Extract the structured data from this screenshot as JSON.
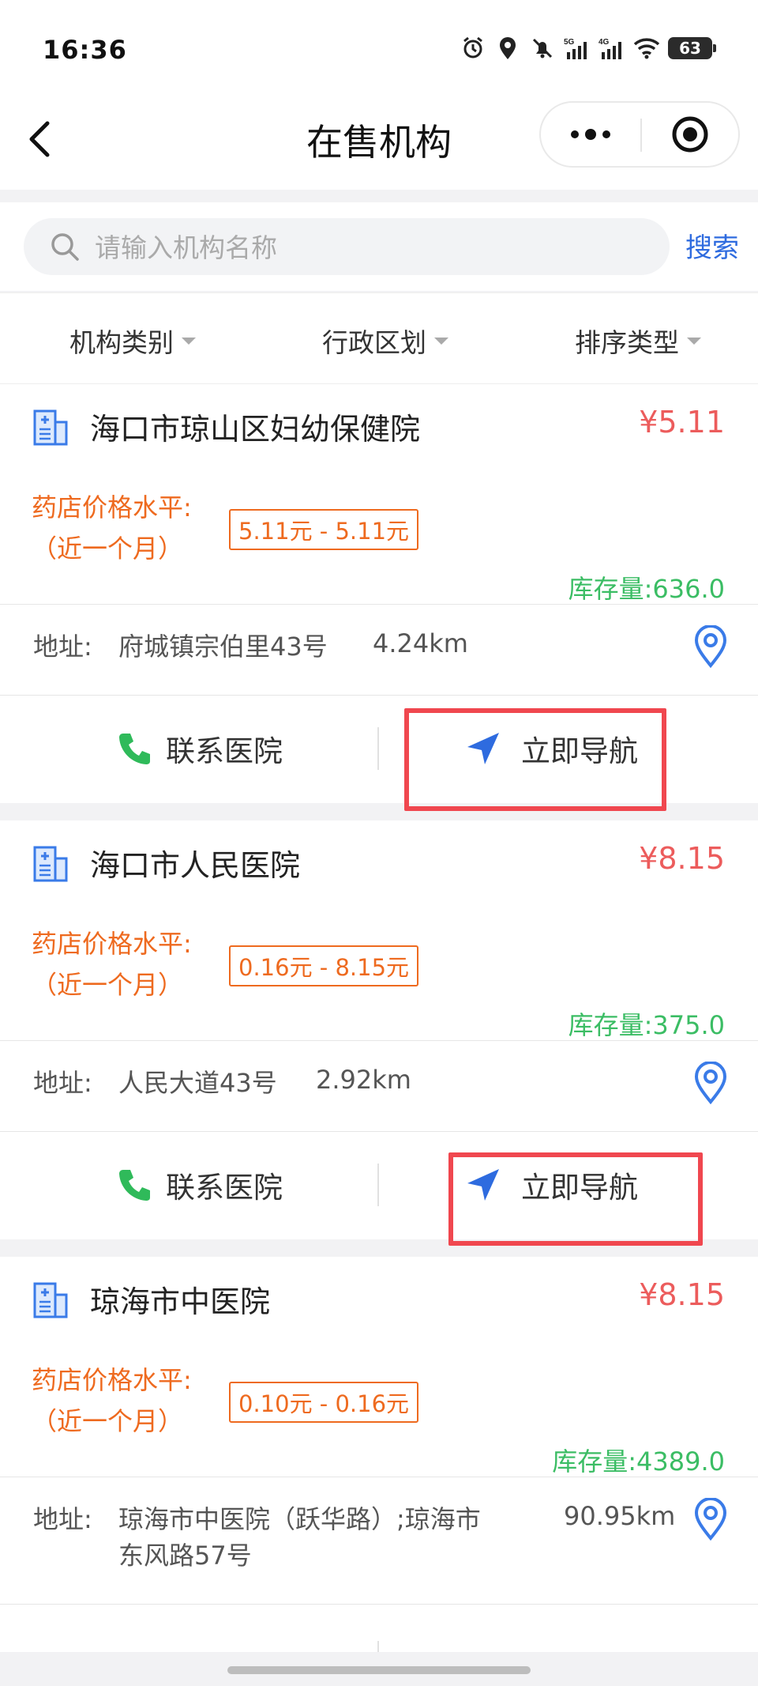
{
  "status": {
    "time": "16:36",
    "battery": "63",
    "net1": "5G",
    "net2": "4G"
  },
  "nav": {
    "title": "在售机构"
  },
  "search": {
    "placeholder": "请输入机构名称",
    "button": "搜索"
  },
  "filters": [
    "机构类别",
    "行政区划",
    "排序类型"
  ],
  "labels": {
    "level_line1": "药店价格水平:",
    "level_line2": "（近一个月）",
    "stock_prefix": "库存量:",
    "addr_prefix": "地址:",
    "call": "联系医院",
    "navigate": "立即导航"
  },
  "cards": [
    {
      "name": "海口市琼山区妇幼保健院",
      "price": "¥5.11",
      "range": "5.11元 - 5.11元",
      "stock": "636.0",
      "address": "府城镇宗伯里43号",
      "distance": "4.24km"
    },
    {
      "name": "海口市人民医院",
      "price": "¥8.15",
      "range": "0.16元 - 8.15元",
      "stock": "375.0",
      "address": "人民大道43号",
      "distance": "2.92km"
    },
    {
      "name": "琼海市中医院",
      "price": "¥8.15",
      "range": "0.10元 - 0.16元",
      "stock": "4389.0",
      "address_line1": "琼海市中医院（跃华路）;琼海市",
      "address_line2": "东风路57号",
      "distance": "90.95km"
    }
  ],
  "colors": {
    "price": "#ec5c5c",
    "level": "#ee6a1f",
    "stock": "#3bbd64",
    "accent": "#2e6bdf",
    "highlight": "#f0474f"
  }
}
